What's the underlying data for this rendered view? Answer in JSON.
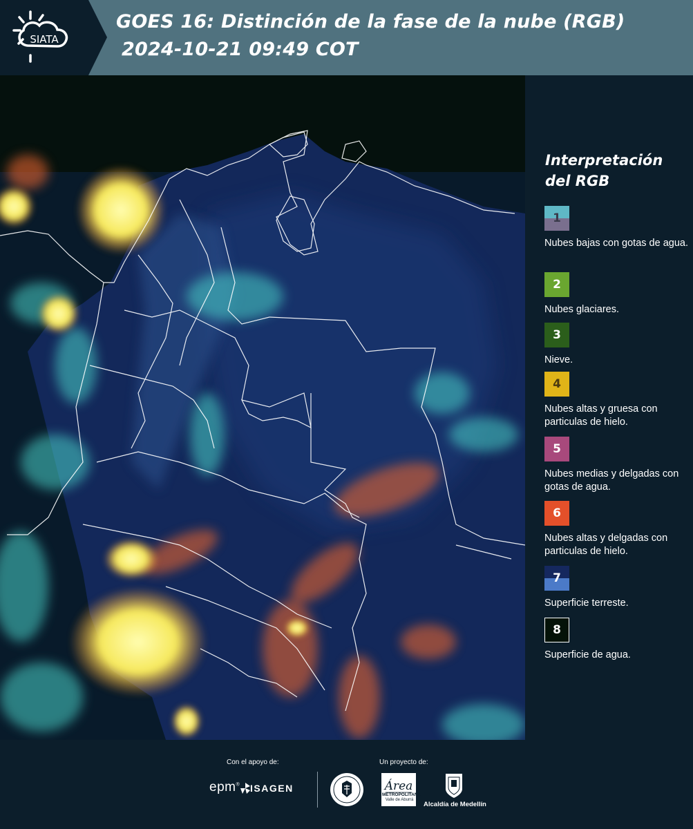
{
  "header": {
    "logo_text": "SIATA",
    "title_line1": "GOES 16: Distinción de la fase de la nube (RGB)",
    "title_line2": "2024-10-21 09:49 COT"
  },
  "legend": {
    "title_line1": "Interpretación",
    "title_line2": "del RGB",
    "items": [
      {
        "number": "1",
        "label": "Nubes bajas con gotas de agua.",
        "color_top": "#5fb8c6",
        "color_bottom": "#7a6f8e",
        "text_color": "#3a3a4a"
      },
      {
        "number": "2",
        "label": "Nubes glaciares.",
        "color": "#6aa630",
        "text_color": "#ffffff"
      },
      {
        "number": "3",
        "label": "Nieve.",
        "color": "#2b5e1b",
        "text_color": "#ffffff"
      },
      {
        "number": "4",
        "label": "Nubes altas y gruesa con particulas de hielo.",
        "color": "#e0b418",
        "text_color": "#4a3a10"
      },
      {
        "number": "5",
        "label": "Nubes medias y delgadas con gotas de agua.",
        "color": "#a8497c",
        "text_color": "#ffffff"
      },
      {
        "number": "6",
        "label": "Nubes altas y delgadas con particulas de hielo.",
        "color": "#e4502a",
        "text_color": "#ffffff"
      },
      {
        "number": "7",
        "label": "Superficie terreste.",
        "color_top": "#15285e",
        "color_bottom": "#4b7ac8",
        "text_color": "#ffffff"
      },
      {
        "number": "8",
        "label": "Superficie de agua.",
        "color": "#041208",
        "border": "#ffffff",
        "text_color": "#ffffff"
      }
    ]
  },
  "footer": {
    "support_label": "Con el apoyo de:",
    "project_label": "Un proyecto de:",
    "epm": "epm",
    "isagen": "ISAGEN",
    "area_name": "METROPOLITANA",
    "area_sub": "Valle de Aburrá",
    "alcaldia": "Alcaldía de Medellín"
  }
}
